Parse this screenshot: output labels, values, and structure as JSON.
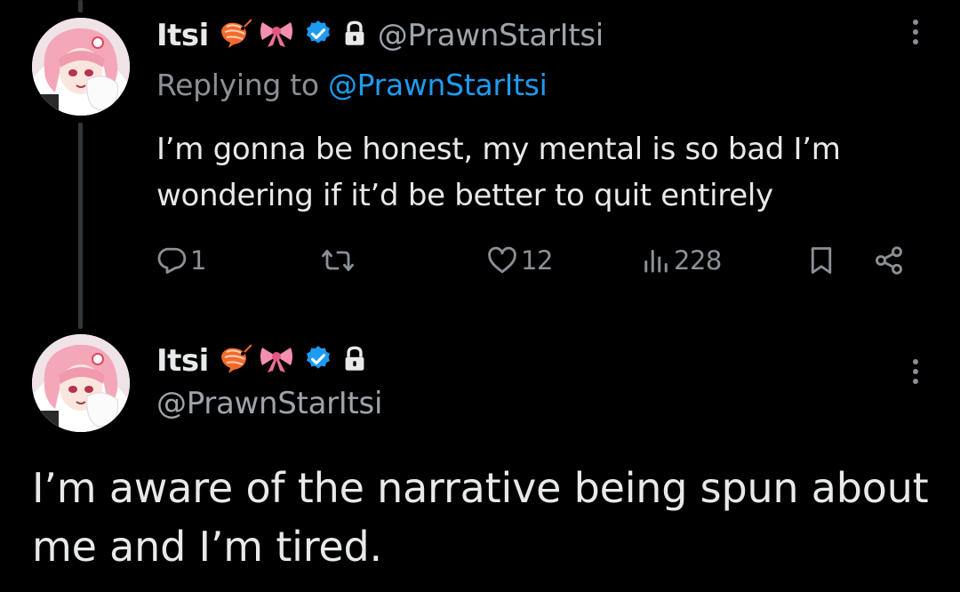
{
  "reply_tweet": {
    "display_name": "Itsi",
    "handle": "@PrawnStarItsi",
    "replying_prefix": "Replying to",
    "replying_handle": "@PrawnStarItsi",
    "text": "I’m gonna be honest, my mental is so bad I’m wondering if it’d be better to quit entirely",
    "reply_count": "1",
    "like_count": "12",
    "view_count": "228",
    "icons": [
      "shrimp-emoji",
      "ribbon-emoji",
      "verified-badge-icon",
      "lock-icon",
      "more-icon",
      "reply-icon",
      "retweet-icon",
      "like-icon",
      "views-icon",
      "bookmark-icon",
      "share-icon"
    ]
  },
  "main_tweet": {
    "display_name": "Itsi",
    "handle": "@PrawnStarItsi",
    "text": "I’m aware of the narrative being spun about me and I’m tired."
  },
  "colors": {
    "background": "#000000",
    "text": "#e7e9ea",
    "muted": "#8b9096",
    "accent": "#1d9bf0",
    "thread_line": "#333639"
  }
}
